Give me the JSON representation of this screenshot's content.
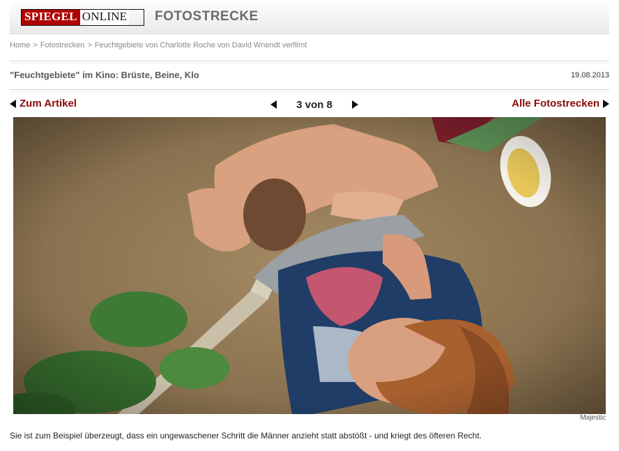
{
  "header": {
    "logo_red": "SPIEGEL",
    "logo_dark": "ONLINE",
    "section": "FOTOSTRECKE"
  },
  "breadcrumb": [
    "Home",
    "Fotostrecken",
    "Feuchtgebiete von Charlotte Roche von David Wnendt verfilmt"
  ],
  "breadcrumb_sep": ">",
  "article": {
    "title": "\"Feuchtgebiete\" im Kino: Brüste, Beine, Klo",
    "date": "19.08.2013"
  },
  "nav": {
    "back_label": "Zum Artikel",
    "pager": "3 von 8",
    "all_label": "Alle Fotostrecken"
  },
  "photo": {
    "credit": "Majestic",
    "caption": "Sie ist zum Beispiel überzeugt, dass ein ungewaschener Schritt die Männer anzieht statt abstößt - und kriegt des öfteren Recht."
  },
  "icons": {
    "prev": "triangle-left-icon",
    "next": "triangle-right-icon"
  },
  "colors": {
    "logo_red": "#b00000",
    "link_red": "#8b0a0a"
  }
}
